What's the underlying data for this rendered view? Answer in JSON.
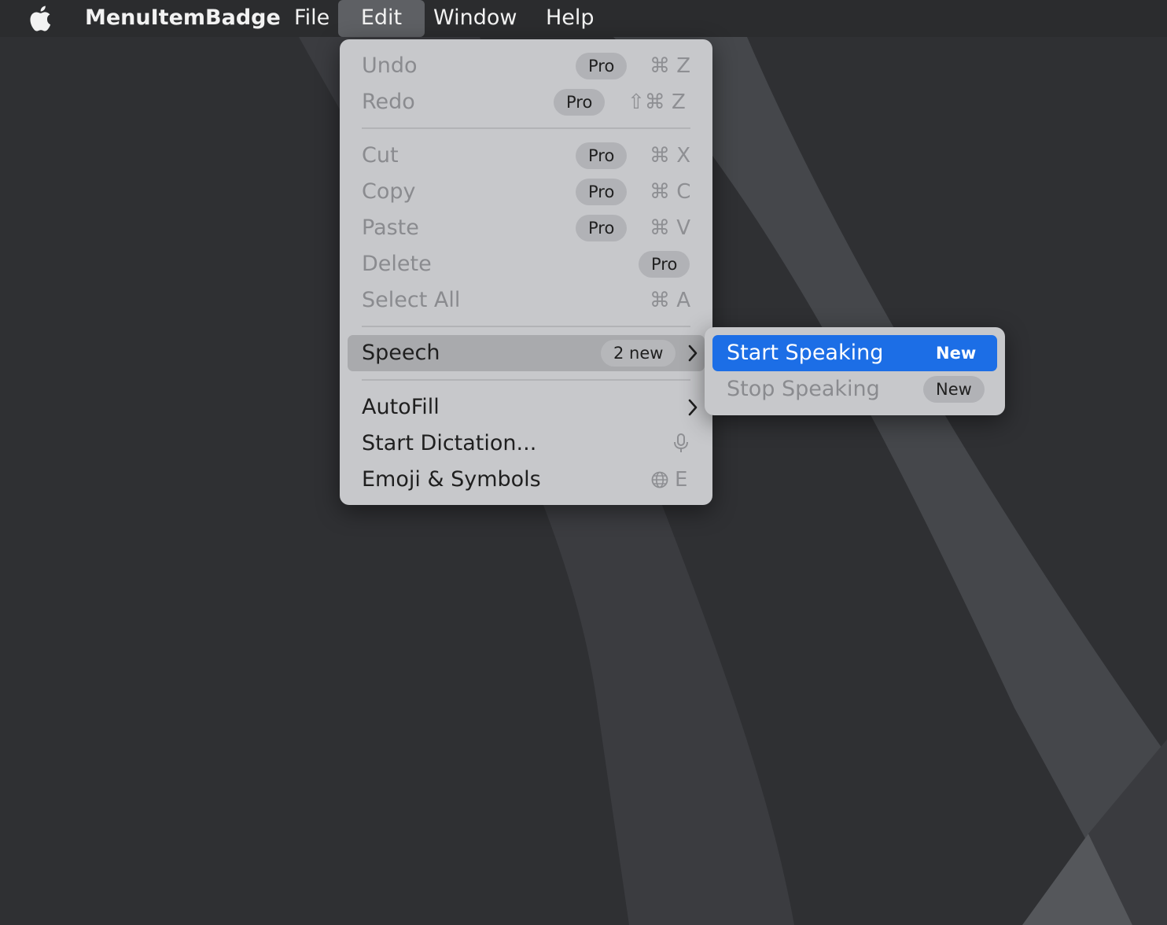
{
  "menubar": {
    "app_name": "MenuItemBadge",
    "items": [
      "File",
      "Edit",
      "Window",
      "Help"
    ],
    "active_item": "Edit"
  },
  "edit_menu": {
    "items": [
      {
        "label": "Undo",
        "badge": "Pro",
        "shortcut": "⌘ Z",
        "enabled": false
      },
      {
        "label": "Redo",
        "badge": "Pro",
        "shortcut": "⇧⌘ Z",
        "enabled": false
      },
      {
        "label": "Cut",
        "badge": "Pro",
        "shortcut": "⌘ X",
        "enabled": false
      },
      {
        "label": "Copy",
        "badge": "Pro",
        "shortcut": "⌘ C",
        "enabled": false
      },
      {
        "label": "Paste",
        "badge": "Pro",
        "shortcut": "⌘ V",
        "enabled": false
      },
      {
        "label": "Delete",
        "badge": "Pro",
        "shortcut": "",
        "enabled": false
      },
      {
        "label": "Select All",
        "badge": "",
        "shortcut": "⌘ A",
        "enabled": false
      },
      {
        "label": "Speech",
        "badge": "2 new",
        "submenu": true,
        "enabled": true,
        "highlighted": true
      },
      {
        "label": "AutoFill",
        "submenu": true,
        "enabled": true
      },
      {
        "label": "Start Dictation...",
        "shortcut_icon": "microphone-icon",
        "enabled": true
      },
      {
        "label": "Emoji & Symbols",
        "shortcut_icon": "globe-icon",
        "shortcut": "E",
        "enabled": true
      }
    ]
  },
  "speech_submenu": {
    "items": [
      {
        "label": "Start Speaking",
        "badge": "New",
        "enabled": true,
        "selected": true
      },
      {
        "label": "Stop Speaking",
        "badge": "New",
        "enabled": false
      }
    ]
  },
  "colors": {
    "accent": "#1c6ee6",
    "menu_background": "#c7c8cb",
    "menubar": "#2b2c2e",
    "badge_background": "#b1b2b6"
  }
}
